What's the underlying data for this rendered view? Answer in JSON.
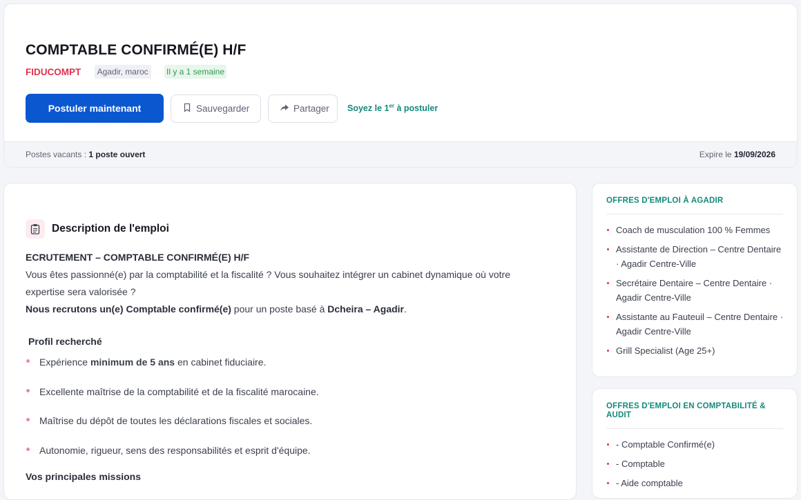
{
  "job": {
    "title": "COMPTABLE CONFIRMÉ(E) H/F",
    "company": "FIDUCOMPT",
    "location": "Agadir, maroc",
    "posted": "Il y a 1 semaine"
  },
  "actions": {
    "apply_label": "Postuler maintenant",
    "save_label": "Sauvegarder",
    "share_label": "Partager",
    "first_prefix": "Soyez le 1",
    "first_sup": "er",
    "first_suffix": " à postuler"
  },
  "footer": {
    "vacancies_label": "Postes vacants : ",
    "vacancies_value": "1 poste ouvert",
    "expires_label": "Expire le ",
    "expires_value": "19/09/2026"
  },
  "description": {
    "section_title": "Description de l'emploi",
    "heading": "ECRUTEMENT – COMPTABLE CONFIRMÉ(E) H/F",
    "intro": "Vous êtes passionné(e) par la comptabilité et la fiscalité ? Vous souhaitez intégrer un cabinet dynamique où votre expertise sera valorisée ?",
    "recruit_bold": "Nous recrutons un(e) Comptable confirmé(e)",
    "recruit_mid": " pour un poste basé à ",
    "recruit_place": "Dcheira – Agadir",
    "recruit_end": ".",
    "profile_title": "Profil recherché",
    "bullet1_pre": "Expérience ",
    "bullet1_bold": "minimum de 5 ans",
    "bullet1_post": " en cabinet fiduciaire.",
    "bullet2": "Excellente maîtrise de la comptabilité et de la fiscalité marocaine.",
    "bullet3": "Maîtrise du dépôt de toutes les déclarations fiscales et sociales.",
    "bullet4": "Autonomie, rigueur, sens des responsabilités et esprit d'équipe.",
    "missions_title": "Vos principales missions"
  },
  "sidebar": {
    "agadir": {
      "title": "OFFRES D'EMPLOI À AGADIR",
      "items": [
        "Coach de musculation 100 % Femmes",
        "Assistante de Direction – Centre Dentaire · Agadir Centre-Ville",
        "Secrétaire Dentaire – Centre Dentaire · Agadir Centre-Ville",
        "Assistante au Fauteuil – Centre Dentaire · Agadir Centre-Ville",
        "Grill Specialist (Age 25+)"
      ]
    },
    "compta": {
      "title": "OFFRES D'EMPLOI EN COMPTABILITÉ & AUDIT",
      "items": [
        "- Comptable Confirmé(e)",
        "- Comptable",
        "- Aide comptable"
      ]
    }
  },
  "colors": {
    "primary": "#0b57d0",
    "company": "#e2304f",
    "accent": "#128a7a"
  }
}
